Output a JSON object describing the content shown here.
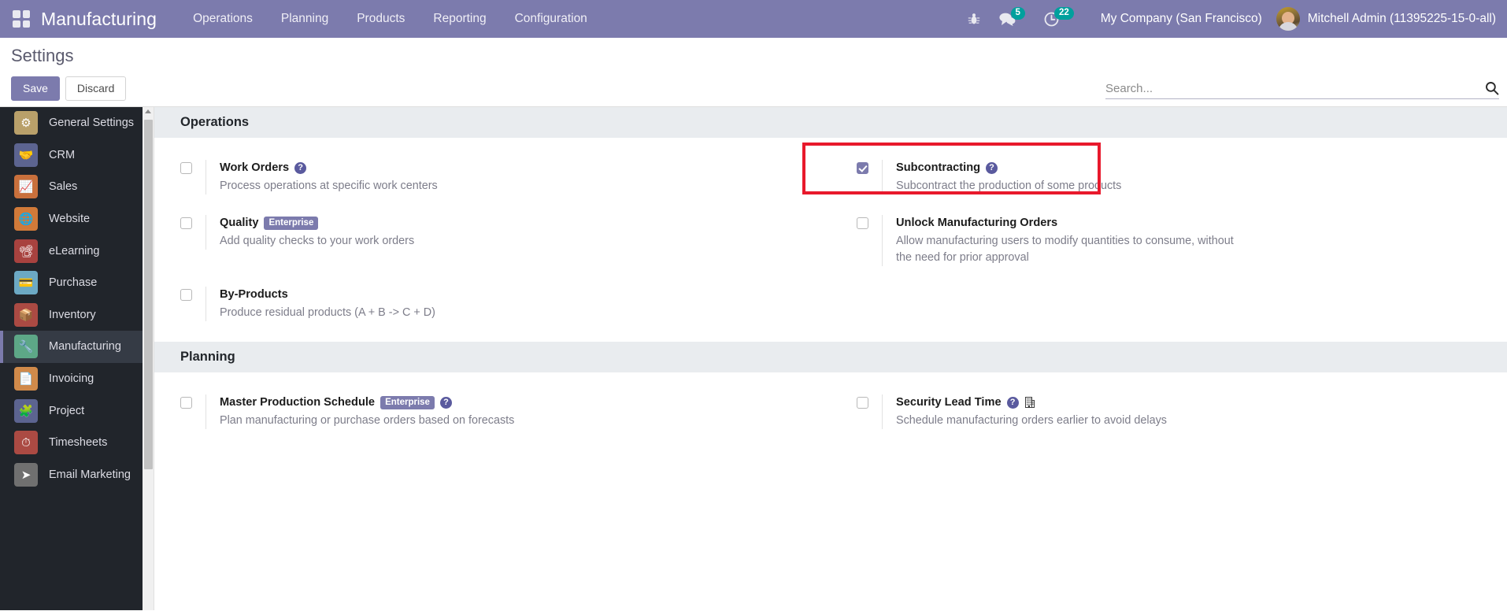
{
  "topbar": {
    "apps_icon": "apps-grid-icon",
    "brand": "Manufacturing",
    "menus": [
      {
        "label": "Operations"
      },
      {
        "label": "Planning"
      },
      {
        "label": "Products"
      },
      {
        "label": "Reporting"
      },
      {
        "label": "Configuration"
      }
    ],
    "icons": [
      {
        "name": "bug-icon",
        "glyph": "🐞",
        "badge": null
      },
      {
        "name": "messages-icon",
        "glyph": "💬",
        "badge": "5"
      },
      {
        "name": "activities-clock-icon",
        "glyph": "🕓",
        "badge": "22"
      }
    ],
    "company": "My Company (San Francisco)",
    "user": "Mitchell Admin (11395225-15-0-all)",
    "accent_color": "#7c7bad",
    "badge_color": "#00a09d"
  },
  "controlpanel": {
    "title": "Settings",
    "save_label": "Save",
    "discard_label": "Discard",
    "search_placeholder": "Search...",
    "search_value": ""
  },
  "sidebar": {
    "items": [
      {
        "label": "General Settings",
        "icon": "gear-icon",
        "color": "#b9a06a",
        "glyph": "⚙",
        "active": false
      },
      {
        "label": "CRM",
        "icon": "handshake-icon",
        "color": "#5c6490",
        "glyph": "🤝",
        "active": false
      },
      {
        "label": "Sales",
        "icon": "chart-line-icon",
        "color": "#c9703c",
        "glyph": "📈",
        "active": false
      },
      {
        "label": "Website",
        "icon": "globe-icon",
        "color": "#d17a39",
        "glyph": "🌐",
        "active": false
      },
      {
        "label": "eLearning",
        "icon": "elearning-icon",
        "color": "#a8423f",
        "glyph": "📽",
        "active": false
      },
      {
        "label": "Purchase",
        "icon": "card-icon",
        "color": "#6ca9c4",
        "glyph": "💳",
        "active": false
      },
      {
        "label": "Inventory",
        "icon": "box-icon",
        "color": "#ab4a43",
        "glyph": "📦",
        "active": false
      },
      {
        "label": "Manufacturing",
        "icon": "wrench-icon",
        "color": "#5da787",
        "glyph": "🔧",
        "active": true
      },
      {
        "label": "Invoicing",
        "icon": "invoice-icon",
        "color": "#d08a4a",
        "glyph": "📄",
        "active": false
      },
      {
        "label": "Project",
        "icon": "puzzle-icon",
        "color": "#5c6490",
        "glyph": "🧩",
        "active": false
      },
      {
        "label": "Timesheets",
        "icon": "stopwatch-icon",
        "color": "#ab4a43",
        "glyph": "⏱",
        "active": false
      },
      {
        "label": "Email Marketing",
        "icon": "paper-plane-icon",
        "color": "#707070",
        "glyph": "➤",
        "active": false
      }
    ]
  },
  "sections": [
    {
      "name": "operations",
      "title": "Operations",
      "settings": [
        {
          "name": "work-orders",
          "title": "Work Orders",
          "desc": "Process operations at specific work centers",
          "checked": false,
          "help": true,
          "enterprise": false,
          "company_icon": false,
          "highlighted": false
        },
        {
          "name": "subcontracting",
          "title": "Subcontracting",
          "desc": "Subcontract the production of some products",
          "checked": true,
          "help": true,
          "enterprise": false,
          "company_icon": false,
          "highlighted": true
        },
        {
          "name": "quality",
          "title": "Quality",
          "desc": "Add quality checks to your work orders",
          "checked": false,
          "help": false,
          "enterprise": true,
          "company_icon": false,
          "highlighted": false
        },
        {
          "name": "unlock-manufacturing-orders",
          "title": "Unlock Manufacturing Orders",
          "desc": "Allow manufacturing users to modify quantities to consume, without the need for prior approval",
          "checked": false,
          "help": false,
          "enterprise": false,
          "company_icon": false,
          "highlighted": false
        },
        {
          "name": "by-products",
          "title": "By-Products",
          "desc": "Produce residual products (A + B -> C + D)",
          "checked": false,
          "help": false,
          "enterprise": false,
          "company_icon": false,
          "highlighted": false
        }
      ]
    },
    {
      "name": "planning",
      "title": "Planning",
      "settings": [
        {
          "name": "master-production-schedule",
          "title": "Master Production Schedule",
          "desc": "Plan manufacturing or purchase orders based on forecasts",
          "checked": false,
          "help": true,
          "enterprise": true,
          "company_icon": false,
          "highlighted": false
        },
        {
          "name": "security-lead-time",
          "title": "Security Lead Time",
          "desc": "Schedule manufacturing orders earlier to avoid delays",
          "checked": false,
          "help": true,
          "enterprise": false,
          "company_icon": true,
          "highlighted": false
        }
      ]
    }
  ],
  "annotation": {
    "color": "#e8192c",
    "target": "subcontracting"
  },
  "badge_labels": {
    "enterprise": "Enterprise"
  },
  "help_glyph": "?"
}
